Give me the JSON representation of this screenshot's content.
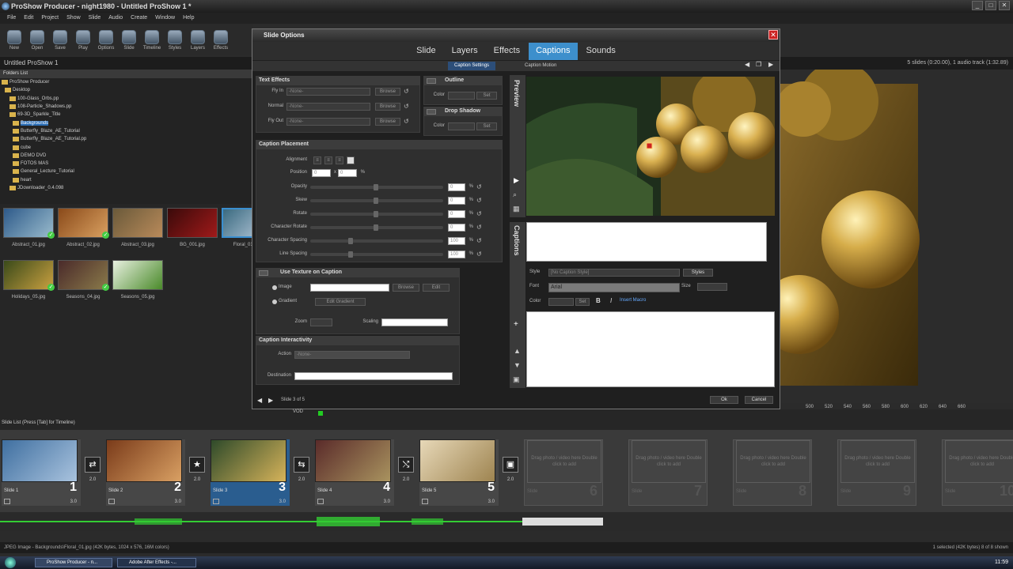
{
  "app": {
    "title": "ProShow Producer - night1980 - Untitled ProShow 1 *",
    "window_buttons": [
      "_",
      "□",
      "✕"
    ]
  },
  "menu": [
    "File",
    "Edit",
    "Project",
    "Show",
    "Slide",
    "Audio",
    "Create",
    "Window",
    "Help"
  ],
  "toolbar": [
    "New",
    "Open",
    "Save",
    "Play",
    "Options",
    "Slide",
    "Timeline",
    "Styles",
    "Layers",
    "Effects"
  ],
  "project_name": "Untitled ProShow 1",
  "show_info": "5 slides (0:20.00), 1 audio track (1:32.89)",
  "folders": {
    "header": "Folders List",
    "items": [
      "ProShow Producer",
      "Desktop",
      "100-Glass_Orbs.pp",
      "108-Particle_Shadows.pp",
      "69-3D_Sparkle_Title",
      "Backgrounds",
      "Butterfly_Blaze_AE_Tutorial",
      "Butterfly_Blaze_AE_Tutorial.pp",
      "cube",
      "DEMO DVD",
      "FOTOS MAS",
      "General_Lecture_Tutorial",
      "heart",
      "JDownloader_0.4.098"
    ]
  },
  "files": [
    {
      "name": "Abstract_01.jpg",
      "checked": true
    },
    {
      "name": "Abstract_02.jpg",
      "checked": true
    },
    {
      "name": "Abstract_03.jpg",
      "checked": false
    },
    {
      "name": "BG_001.jpg",
      "checked": false
    },
    {
      "name": "Floral_01.jpg",
      "checked": false
    },
    {
      "name": "Holidays_05.jpg",
      "checked": true
    },
    {
      "name": "Seasons_04.jpg",
      "checked": true
    },
    {
      "name": "Seasons_05.jpg",
      "checked": false
    }
  ],
  "dialog": {
    "title": "Slide Options",
    "tabs": [
      "Slide",
      "Layers",
      "Effects",
      "Captions",
      "Sounds"
    ],
    "active_tab": "Captions",
    "subtabs": [
      "Caption Settings",
      "Caption Motion"
    ],
    "text_effects": {
      "title": "Text Effects",
      "labels": [
        "Fly In",
        "Normal",
        "Fly Out"
      ],
      "values": [
        "-None-",
        "-None-",
        "-None-"
      ],
      "browse": "Browse"
    },
    "outline": {
      "title": "Outline",
      "color_label": "Color",
      "set": "Set",
      "off": "OFF"
    },
    "drop_shadow": {
      "title": "Drop Shadow",
      "color_label": "Color",
      "set": "Set",
      "off": "OFF"
    },
    "placement": {
      "title": "Caption Placement",
      "alignment": "Alignment",
      "position": "Position",
      "pos_x": "0",
      "pos_y": "0",
      "sliders": [
        {
          "label": "Opacity",
          "value": "0"
        },
        {
          "label": "Skew",
          "value": "0"
        },
        {
          "label": "Rotate",
          "value": "0"
        },
        {
          "label": "Character Rotate",
          "value": "0"
        },
        {
          "label": "Character Spacing",
          "value": "100"
        },
        {
          "label": "Line Spacing",
          "value": "100"
        }
      ],
      "pct": "%"
    },
    "texture": {
      "title": "Use Texture on Caption",
      "off": "OFF",
      "image": "Image",
      "gradient": "Gradient",
      "browse": "Browse",
      "edit": "Edit",
      "edit_gradient": "Edit Gradient",
      "zoom": "Zoom",
      "scaling": "Scaling"
    },
    "interactivity": {
      "title": "Caption Interactivity",
      "action_label": "Action",
      "action_value": "-None-",
      "destination_label": "Destination"
    },
    "preview_label": "Preview",
    "captions_label": "Captions",
    "style_label": "Style",
    "style_value": "[No Caption Style]",
    "styles_btn": "Styles",
    "font_label": "Font",
    "font_value": "Arial",
    "size_label": "Size",
    "color_label": "Color",
    "set": "Set",
    "bold": "B",
    "italic": "I",
    "insert_macro": "Insert Macro",
    "slide_counter": "Slide 3 of 5",
    "ok": "Ok",
    "cancel": "Cancel"
  },
  "timeline": {
    "label": "Slide List (Press [Tab] for Timeline)",
    "vod": "VOD",
    "ticks": [
      "500",
      "520",
      "540",
      "560",
      "580",
      "600",
      "620",
      "640",
      "660"
    ]
  },
  "slides": [
    {
      "name": "Slide 1",
      "num": "1",
      "dur": "3.0",
      "trans": "2.0",
      "colors": [
        "#3f6fa0",
        "#a9c3de"
      ]
    },
    {
      "name": "Slide 2",
      "num": "2",
      "dur": "3.0",
      "trans": "2.0",
      "colors": [
        "#7a3b1a",
        "#d9a063"
      ]
    },
    {
      "name": "Slide 3",
      "num": "3",
      "dur": "3.0",
      "trans": "2.0",
      "colors": [
        "#2e4a2a",
        "#d6b35a"
      ]
    },
    {
      "name": "Slide 4",
      "num": "4",
      "dur": "3.0",
      "trans": "2.0",
      "colors": [
        "#5a2b2a",
        "#a9935f"
      ]
    },
    {
      "name": "Slide 5",
      "num": "5",
      "dur": "3.0",
      "trans": "2.0",
      "colors": [
        "#e7d8b8",
        "#9e8450"
      ]
    }
  ],
  "empty_slots": [
    {
      "text": "Drag photo / video here Double click to add",
      "num": "6",
      "name": "Slide"
    },
    {
      "text": "Drag photo / video here Double click to add",
      "num": "7",
      "name": "Slide"
    },
    {
      "text": "Drag photo / video here Double click to add",
      "num": "8",
      "name": "Slide"
    },
    {
      "text": "Drag photo / video here Double click to add",
      "num": "9",
      "name": "Slide"
    },
    {
      "text": "Drag photo / video here Double click to add",
      "num": "10",
      "name": "Slide"
    }
  ],
  "status": {
    "left": "JPEG Image - Backgrounds\\Floral_01.jpg (42K bytes, 1024 x 576, 16M colors)",
    "right": "1 selected (42K bytes) 8 of 8 shown"
  },
  "taskbar": {
    "items": [
      "ProShow Producer - n...",
      "Adobe After Effects -..."
    ],
    "clock": "11:59"
  }
}
